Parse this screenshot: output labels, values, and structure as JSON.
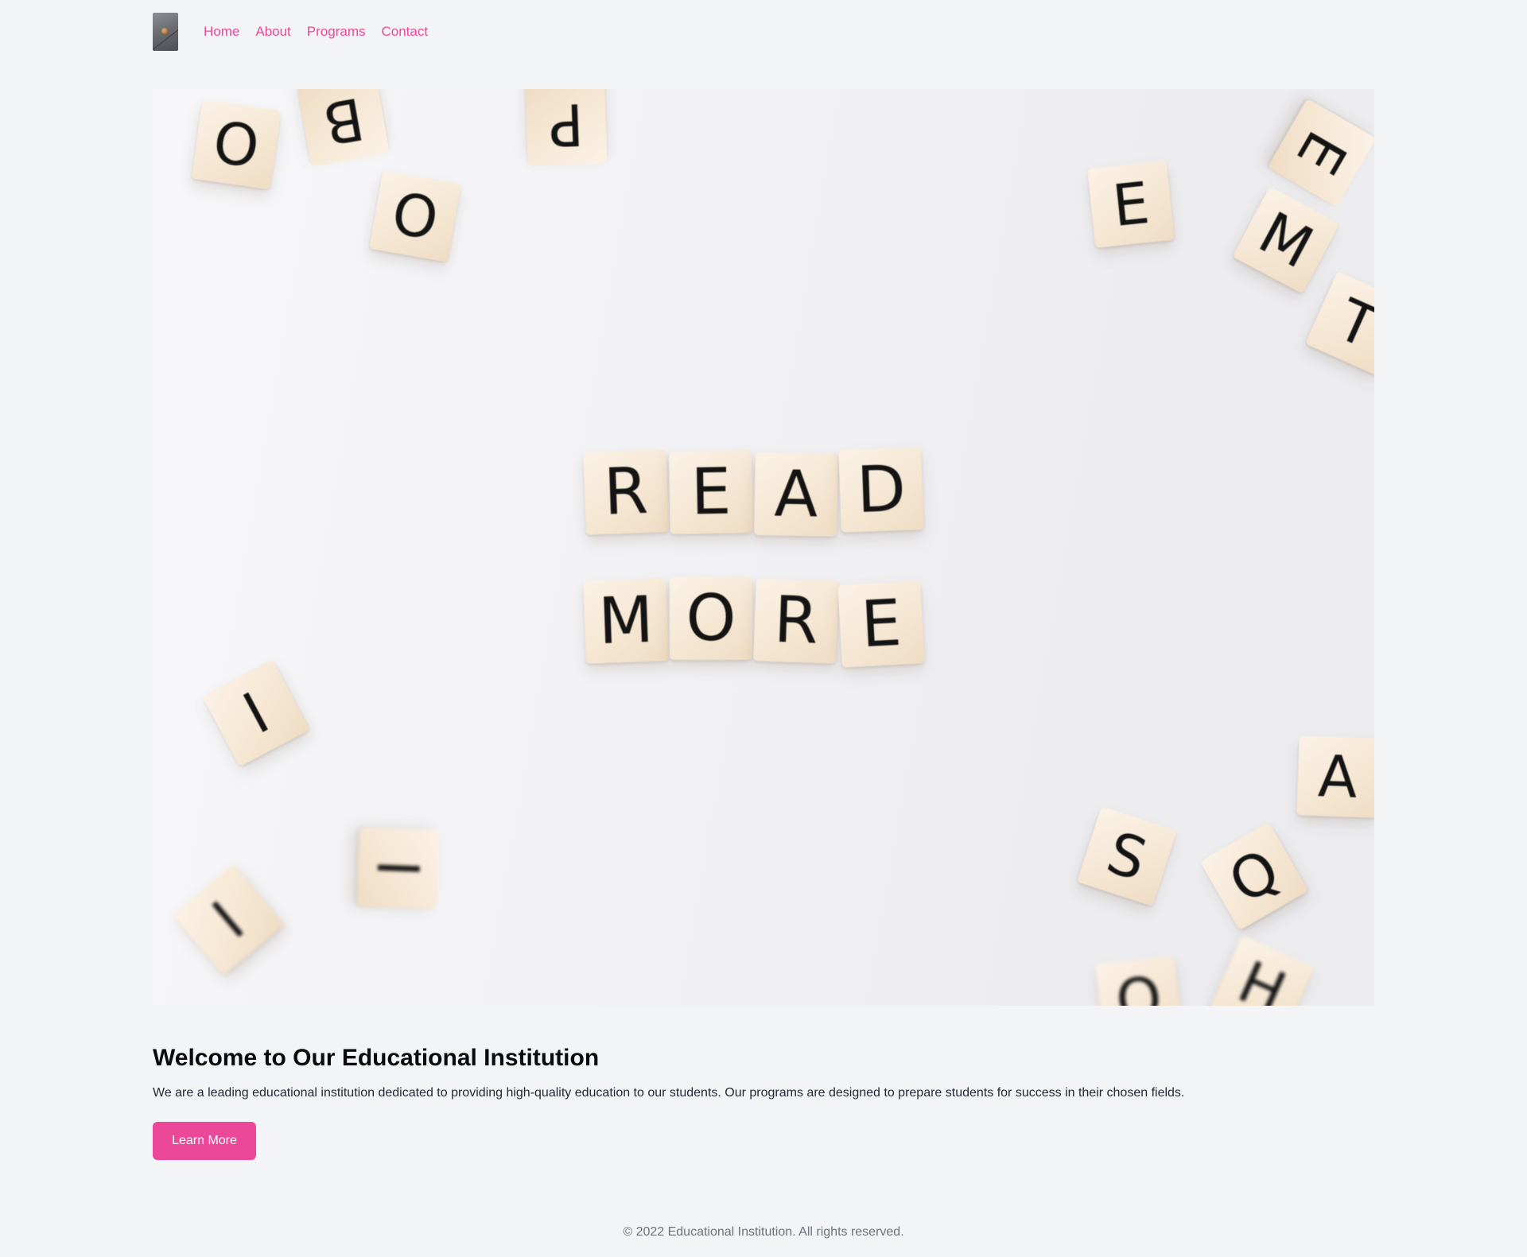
{
  "header": {
    "logo_icon": "logo-image",
    "nav": [
      {
        "label": "Home"
      },
      {
        "label": "About"
      },
      {
        "label": "Programs"
      },
      {
        "label": "Contact"
      }
    ]
  },
  "hero": {
    "image_description_icon": "scrabble-tiles-image",
    "tiles": {
      "r1": [
        "R",
        "E",
        "A",
        "D"
      ],
      "r2": [
        "M",
        "O",
        "R",
        "E"
      ],
      "scatter": [
        "O",
        "B",
        "O",
        "P",
        "E",
        "E",
        "M",
        "T",
        "I",
        "I",
        "I",
        "A",
        "S",
        "Q",
        "O",
        "H"
      ]
    }
  },
  "main": {
    "title": "Welcome to Our Educational Institution",
    "description": "We are a leading educational institution dedicated to providing high-quality education to our students. Our programs are designed to prepare students for success in their chosen fields.",
    "cta_label": "Learn More"
  },
  "footer": {
    "text": "© 2022 Educational Institution. All rights reserved."
  },
  "colors": {
    "accent": "#ec4899",
    "background": "#f3f4f6",
    "text": "#111827"
  }
}
